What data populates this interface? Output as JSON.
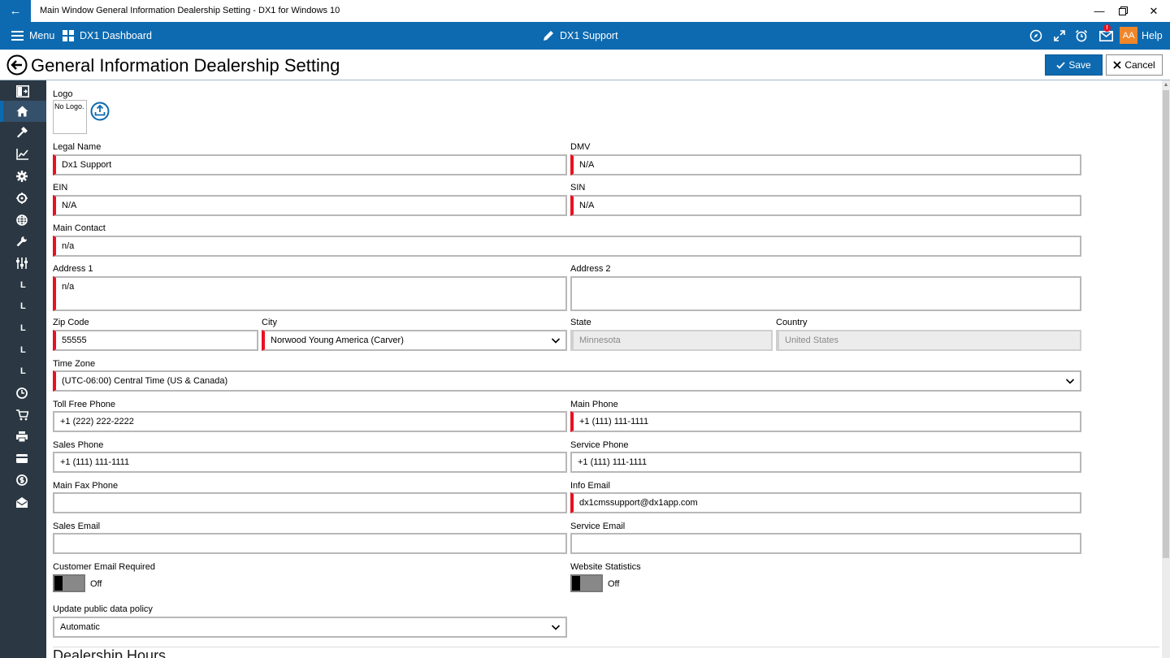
{
  "window": {
    "title": "Main Window General Information Dealership Setting - DX1 for Windows 10"
  },
  "appbar": {
    "menu_label": "Menu",
    "dashboard_label": "DX1 Dashboard",
    "dealer_label": "DX1 Support",
    "notification_count": "!",
    "avatar_initials": "AA",
    "help_label": "Help",
    "accent_color": "#0d6ab0"
  },
  "page": {
    "title": "General Information Dealership Setting",
    "save_label": "Save",
    "cancel_label": "Cancel"
  },
  "sidebar": {
    "items": [
      {
        "icon": "panel-toggle-icon"
      },
      {
        "icon": "home-icon",
        "active": true
      },
      {
        "icon": "hammer-icon"
      },
      {
        "icon": "chart-icon"
      },
      {
        "icon": "gear-icon"
      },
      {
        "icon": "target-icon"
      },
      {
        "icon": "globe-icon"
      },
      {
        "icon": "wrench-icon"
      },
      {
        "icon": "sliders-icon"
      },
      {
        "label": "L"
      },
      {
        "label": "L"
      },
      {
        "label": "L"
      },
      {
        "label": "L"
      },
      {
        "label": "L"
      },
      {
        "icon": "clock-icon"
      },
      {
        "icon": "cart-icon"
      },
      {
        "icon": "printer-icon"
      },
      {
        "icon": "card-icon"
      },
      {
        "icon": "dollar-icon"
      },
      {
        "icon": "mail-open-icon"
      }
    ]
  },
  "form": {
    "logo": {
      "label": "Logo",
      "placeholder": "No Logo."
    },
    "legal_name": {
      "label": "Legal Name",
      "value": "Dx1 Support"
    },
    "dmv": {
      "label": "DMV",
      "value": "N/A"
    },
    "ein": {
      "label": "EIN",
      "value": "N/A"
    },
    "sin": {
      "label": "SIN",
      "value": "N/A"
    },
    "main_contact": {
      "label": "Main Contact",
      "value": "n/a"
    },
    "address1": {
      "label": "Address 1",
      "value": "n/a"
    },
    "address2": {
      "label": "Address 2",
      "value": ""
    },
    "zip": {
      "label": "Zip Code",
      "value": "55555"
    },
    "city": {
      "label": "City",
      "value": "Norwood Young America (Carver)"
    },
    "state": {
      "label": "State",
      "value": "Minnesota"
    },
    "country": {
      "label": "Country",
      "value": "United States"
    },
    "time_zone": {
      "label": "Time Zone",
      "value": "(UTC-06:00) Central Time (US & Canada)"
    },
    "toll_free_phone": {
      "label": "Toll Free Phone",
      "value": "+1 (222) 222-2222"
    },
    "main_phone": {
      "label": "Main Phone",
      "value": "+1 (111) 111-1111"
    },
    "sales_phone": {
      "label": "Sales Phone",
      "value": "+1 (111) 111-1111"
    },
    "service_phone": {
      "label": "Service Phone",
      "value": "+1 (111) 111-1111"
    },
    "main_fax_phone": {
      "label": "Main Fax Phone",
      "value": ""
    },
    "info_email": {
      "label": "Info Email",
      "value": "dx1cmssupport@dx1app.com"
    },
    "sales_email": {
      "label": "Sales Email",
      "value": ""
    },
    "service_email": {
      "label": "Service Email",
      "value": ""
    },
    "customer_email_required": {
      "label": "Customer Email Required",
      "state": "Off"
    },
    "website_statistics": {
      "label": "Website Statistics",
      "state": "Off"
    },
    "update_policy": {
      "label": "Update public data policy",
      "value": "Automatic"
    },
    "required_color": "#e81123"
  },
  "sections": {
    "dealership_hours": "Dealership Hours"
  }
}
